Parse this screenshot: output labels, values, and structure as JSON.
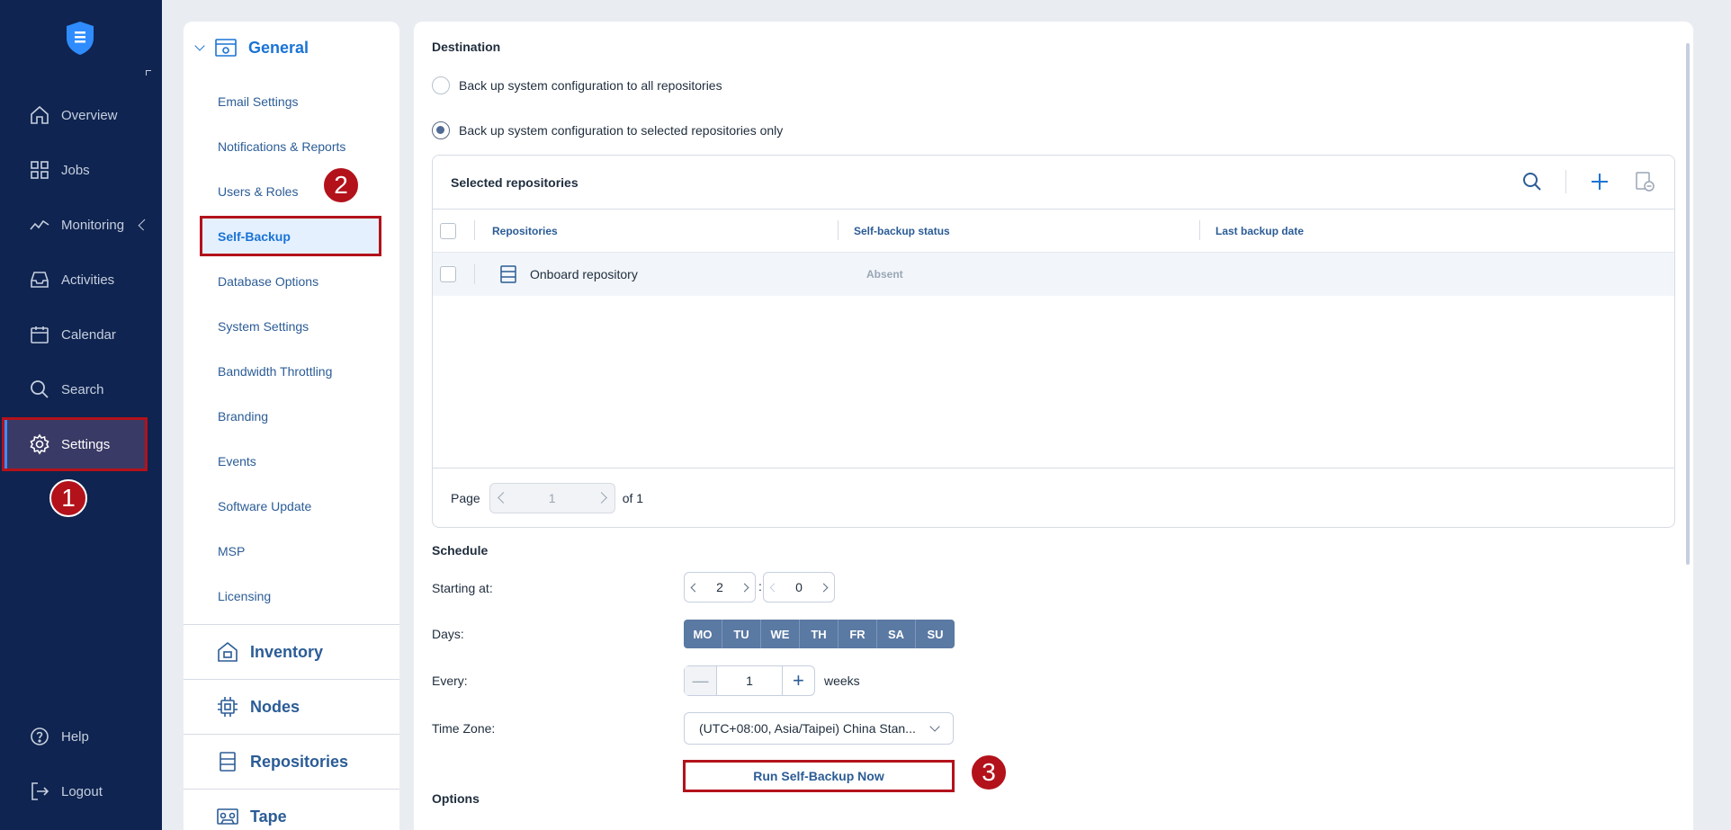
{
  "nav": {
    "items": [
      {
        "label": "Overview",
        "icon": "home-icon"
      },
      {
        "label": "Jobs",
        "icon": "grid-icon"
      },
      {
        "label": "Monitoring",
        "icon": "chart-line-icon"
      },
      {
        "label": "Activities",
        "icon": "inbox-icon"
      },
      {
        "label": "Calendar",
        "icon": "calendar-icon"
      },
      {
        "label": "Search",
        "icon": "search-icon"
      },
      {
        "label": "Settings",
        "icon": "gear-icon",
        "active": true
      }
    ],
    "help": "Help",
    "logout": "Logout",
    "accent": "#3d8eff"
  },
  "badges": [
    "1",
    "2",
    "3"
  ],
  "menu": {
    "general": "General",
    "items": [
      "Email Settings",
      "Notifications & Reports",
      "Users & Roles",
      "Self-Backup",
      "Database Options",
      "System Settings",
      "Bandwidth Throttling",
      "Branding",
      "Events",
      "Software Update",
      "MSP",
      "Licensing"
    ],
    "active": "Self-Backup",
    "sections": [
      "Inventory",
      "Nodes",
      "Repositories",
      "Tape"
    ]
  },
  "destination": {
    "title": "Destination",
    "option_all": "Back up system configuration to all repositories",
    "option_selected": "Back up system configuration to selected repositories only",
    "selected": "option_selected"
  },
  "repositories": {
    "title": "Selected repositories",
    "columns": [
      "Repositories",
      "Self-backup status",
      "Last backup date"
    ],
    "rows": [
      {
        "name": "Onboard repository",
        "status": "Absent",
        "last_backup": ""
      }
    ],
    "page_label": "Page",
    "page": "1",
    "of": "of 1"
  },
  "schedule": {
    "title": "Schedule",
    "starting_label": "Starting at:",
    "hour": "2",
    "colon": ":",
    "minute": "0",
    "days_label": "Days:",
    "days": [
      "MO",
      "TU",
      "WE",
      "TH",
      "FR",
      "SA",
      "SU"
    ],
    "every_label": "Every:",
    "every_value": "1",
    "every_unit": "weeks",
    "tz_label": "Time Zone:",
    "tz_value": "(UTC+08:00, Asia/Taipei) China Stan...",
    "run_button": "Run Self-Backup Now"
  },
  "options": {
    "title": "Options"
  },
  "colors": {
    "nav_bg": "#0f2450",
    "highlight": "#b3121b",
    "link": "#2b5c96",
    "primary": "#1a73d6"
  }
}
